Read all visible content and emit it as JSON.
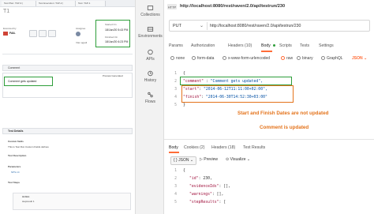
{
  "jira": {
    "tabs": [
      "Test Plan: TAP-3 |",
      "Test Execution: TAP-2 |",
      "Test: TAP-1"
    ],
    "issue_key": "T1",
    "fields": {
      "executed_by_label": "Executed by",
      "status_value": "FAIL",
      "assignee_label": "Assignee",
      "started_label": "Started On",
      "started_value": "18/Jun/20 5:43 PM",
      "finished_label": "Finished On",
      "finished_value": "18/Jun/20 6:23 PM"
    },
    "comment_header": "Comment",
    "comment_preview_label": "Preview Generated",
    "comment_text": "Comment gets updated",
    "test_details_title": "Test Details",
    "custom_fields_label": "Custom fields",
    "custom_fields_text": "This is Test Run Custom Fields defines",
    "test_description_label": "Test Description",
    "parameters_label": "Parameters",
    "test_steps_label": "Test Steps",
    "step_action_label": "Action",
    "step_action_value": "stepresult 1"
  },
  "sidebar": {
    "items": [
      "Collections",
      "Environments",
      "APIs",
      "History",
      "Flows"
    ]
  },
  "request": {
    "title_url": "http://localhost:8080/rest/raven/2.0/api/testrun/230",
    "method": "PUT",
    "url": "http://localhost:8080/rest/raven/2.0/api/testrun/230",
    "tabs": [
      "Params",
      "Authorization",
      "Headers (10)",
      "Body",
      "Scripts",
      "Tests",
      "Settings"
    ],
    "body_types": [
      "none",
      "form-data",
      "x-www-form-urlencoded",
      "raw",
      "binary",
      "GraphQL"
    ],
    "body_format": "JSON",
    "body_lines": [
      {
        "n": "1",
        "text": "{"
      },
      {
        "n": "2",
        "key": "\"comment\"",
        "value": "\"Comment gets updated\","
      },
      {
        "n": "3",
        "key": "\"start\"",
        "value": "\"2014-06-12T11:11:00+02:00\","
      },
      {
        "n": "4",
        "key": "\"finish\"",
        "value": "\"2014-06-30T14:52:30+03:00\""
      },
      {
        "n": "5",
        "text": "}"
      }
    ]
  },
  "annotations": {
    "dates": "Start and Finish Dates are not updated",
    "comment": "Comment is updated"
  },
  "response": {
    "tabs": [
      "Body",
      "Cookies (2)",
      "Headers (18)",
      "Test Results"
    ],
    "format": "JSON",
    "preview": "Preview",
    "visualize": "Visualize",
    "lines": [
      {
        "n": "1",
        "text": "{"
      },
      {
        "n": "2",
        "key": "\"id\"",
        "value": "230,"
      },
      {
        "n": "3",
        "key": "\"evidenceIds\"",
        "value": "[],"
      },
      {
        "n": "4",
        "key": "\"warnings\"",
        "value": "[],"
      },
      {
        "n": "5",
        "key": "\"stepResults\"",
        "value": "["
      }
    ]
  },
  "colors": {
    "green_box": "#2e9e3a",
    "orange_box": "#e4731b",
    "annotation": "#e4731b",
    "fail": "#d04437"
  }
}
